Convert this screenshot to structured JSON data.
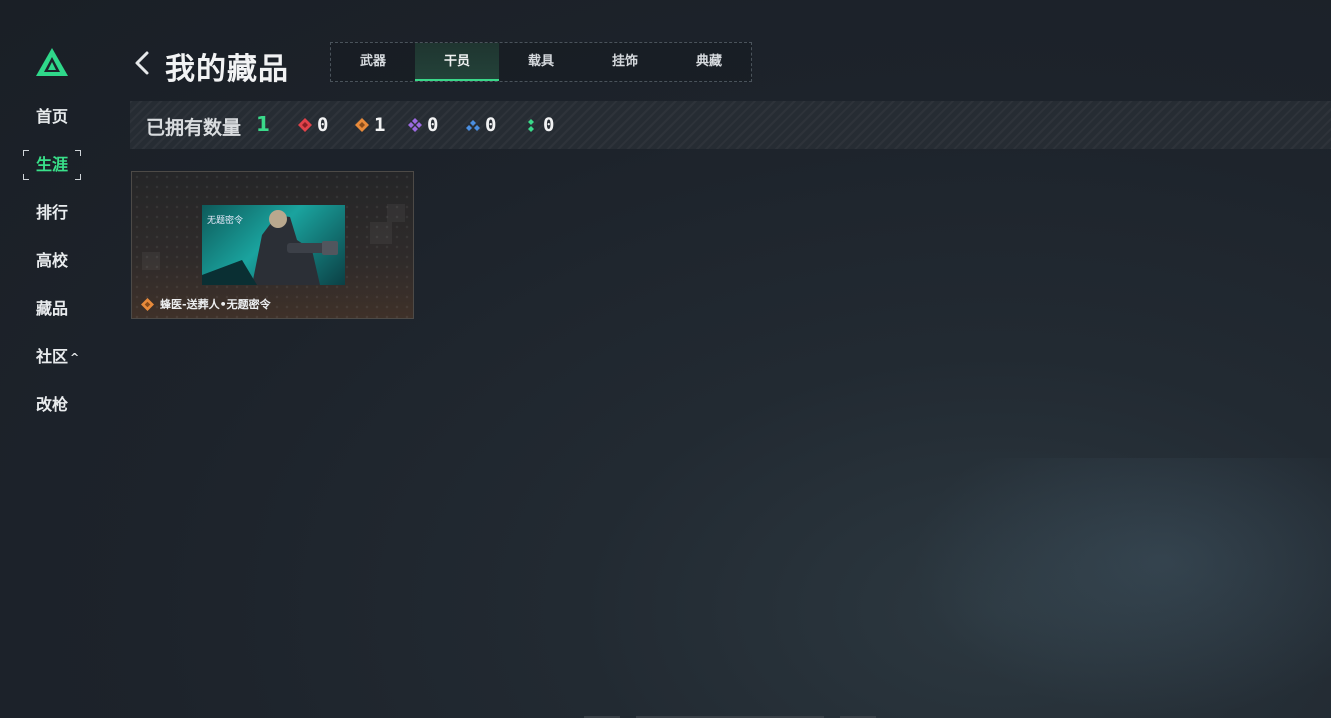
{
  "sidebar": {
    "items": [
      {
        "label": "首页"
      },
      {
        "label": "生涯"
      },
      {
        "label": "排行"
      },
      {
        "label": "高校"
      },
      {
        "label": "藏品"
      },
      {
        "label": "社区"
      },
      {
        "label": "改枪"
      }
    ],
    "active_index": 1
  },
  "header": {
    "title": "我的藏品",
    "tabs": [
      {
        "label": "武器"
      },
      {
        "label": "干员"
      },
      {
        "label": "载具"
      },
      {
        "label": "挂饰"
      },
      {
        "label": "典藏"
      }
    ],
    "active_tab": 1
  },
  "stats": {
    "owned_label": "已拥有数量",
    "owned_count": "1",
    "rarities": [
      {
        "icon": "red-diamond-icon",
        "color": "#e0424a",
        "count": "0"
      },
      {
        "icon": "orange-diamond-icon",
        "color": "#e88a3a",
        "count": "1"
      },
      {
        "icon": "purple-diamond-icon",
        "color": "#9b6ae0",
        "count": "0"
      },
      {
        "icon": "blue-diamond-icon",
        "color": "#4a8ee0",
        "count": "0"
      },
      {
        "icon": "green-diamond-icon",
        "color": "#3ad98a",
        "count": "0"
      }
    ]
  },
  "items": [
    {
      "name": "蜂医-送葬人•无题密令",
      "thumb_text": "无题密令",
      "rarity_color": "#e88a3a"
    }
  ],
  "colors": {
    "accent": "#3ad98a",
    "background": "#1d232b"
  }
}
